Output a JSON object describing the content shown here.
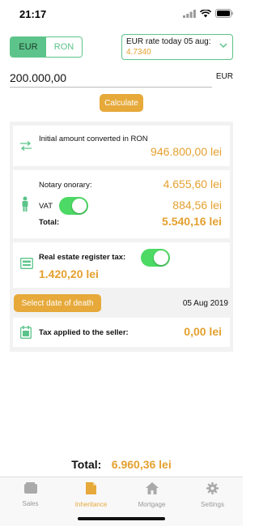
{
  "status": {
    "time": "21:17"
  },
  "currency": {
    "options": [
      "EUR",
      "RON"
    ],
    "selected": "EUR"
  },
  "rate": {
    "label": "EUR rate today 05 aug:",
    "value": "4.7340"
  },
  "amount": {
    "value": "200.000,00",
    "currency": "EUR"
  },
  "calculate_label": "Calculate",
  "converted": {
    "label": "Initial amount converted in RON",
    "value": "946.800,00 lei"
  },
  "notary": {
    "label": "Notary onorary:",
    "value": "4.655,60 lei",
    "vat_label": "VAT",
    "vat_value": "884,56 lei",
    "vat_enabled": true,
    "total_label": "Total:",
    "total_value": "5.540,16 lei"
  },
  "real_estate": {
    "label": "Real estate register tax:",
    "value": "1.420,20 lei",
    "enabled": true
  },
  "date": {
    "button_label": "Select date of death",
    "value": "05 Aug 2019"
  },
  "seller_tax": {
    "label": "Tax applied to the seller:",
    "value": "0,00 lei"
  },
  "grand_total": {
    "label": "Total:",
    "value": "6.960,36 lei"
  },
  "tabs": [
    {
      "label": "Sales",
      "icon": "wallet-icon"
    },
    {
      "label": "Inheritance",
      "icon": "document-icon",
      "active": true
    },
    {
      "label": "Mortgage",
      "icon": "house-icon"
    },
    {
      "label": "Settings",
      "icon": "gear-icon"
    }
  ],
  "colors": {
    "accent_green": "#5cc48a",
    "accent_orange": "#e4a02f",
    "toggle_on": "#4cd964"
  }
}
